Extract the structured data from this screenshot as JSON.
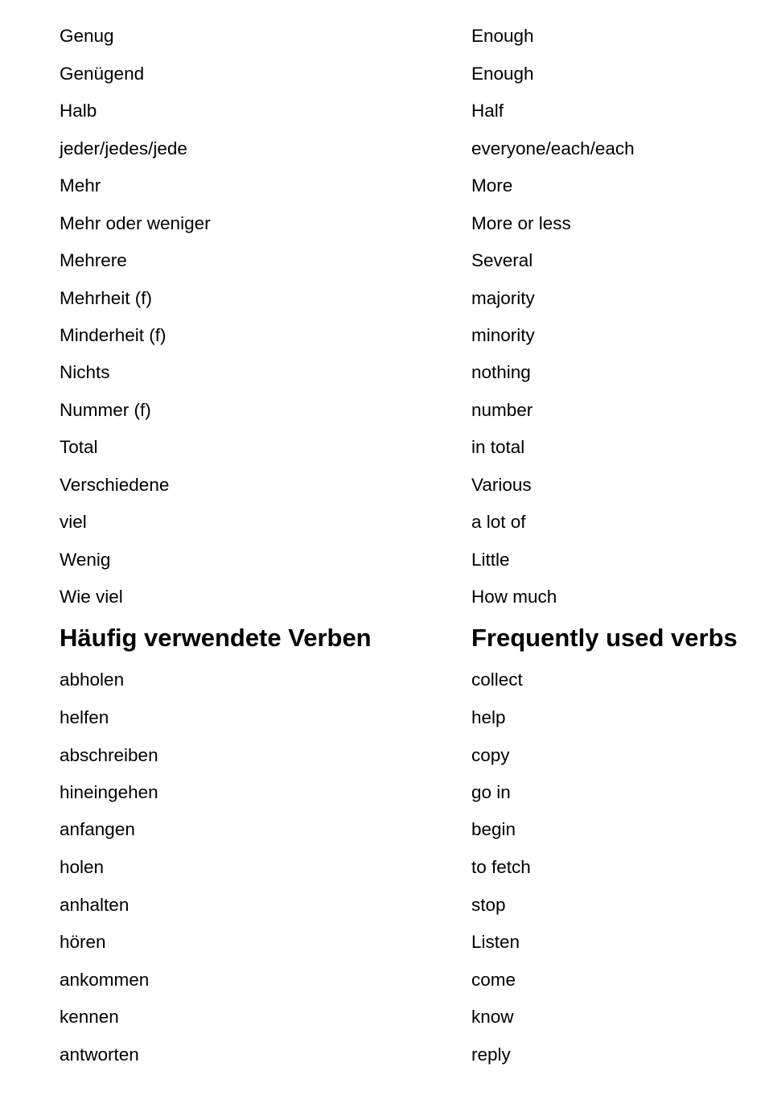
{
  "sections": [
    {
      "rows": [
        {
          "de": "Genug",
          "en": "Enough"
        },
        {
          "de": "Genügend",
          "en": "Enough"
        },
        {
          "de": "Halb",
          "en": "Half"
        },
        {
          "de": "jeder/jedes/jede",
          "en": "everyone/each/each"
        },
        {
          "de": "Mehr",
          "en": "More"
        },
        {
          "de": "Mehr oder weniger",
          "en": "More or less"
        },
        {
          "de": "Mehrere",
          "en": "Several"
        },
        {
          "de": "Mehrheit (f)",
          "en": "majority"
        },
        {
          "de": "Minderheit (f)",
          "en": "minority"
        },
        {
          "de": "Nichts",
          "en": "nothing"
        },
        {
          "de": "Nummer (f)",
          "en": "number"
        },
        {
          "de": "Total",
          "en": "in total"
        },
        {
          "de": "Verschiedene",
          "en": "Various"
        },
        {
          "de": "viel",
          "en": "a lot of"
        },
        {
          "de": "Wenig",
          "en": "Little"
        },
        {
          "de": "Wie viel",
          "en": "How much"
        }
      ]
    },
    {
      "heading": {
        "de": "Häufig verwendete Verben",
        "en": "Frequently used verbs"
      },
      "rows": [
        {
          "de": "abholen",
          "en": "collect"
        },
        {
          "de": "helfen",
          "en": "help"
        },
        {
          "de": "abschreiben",
          "en": "copy"
        },
        {
          "de": "hineingehen",
          "en": "go in"
        },
        {
          "de": "anfangen",
          "en": "begin"
        },
        {
          "de": "holen",
          "en": "to fetch"
        },
        {
          "de": "anhalten",
          "en": "stop"
        },
        {
          "de": "hören",
          "en": "Listen"
        },
        {
          "de": "ankommen",
          "en": "come"
        },
        {
          "de": "kennen",
          "en": "know"
        },
        {
          "de": "antworten",
          "en": "reply"
        }
      ]
    }
  ]
}
